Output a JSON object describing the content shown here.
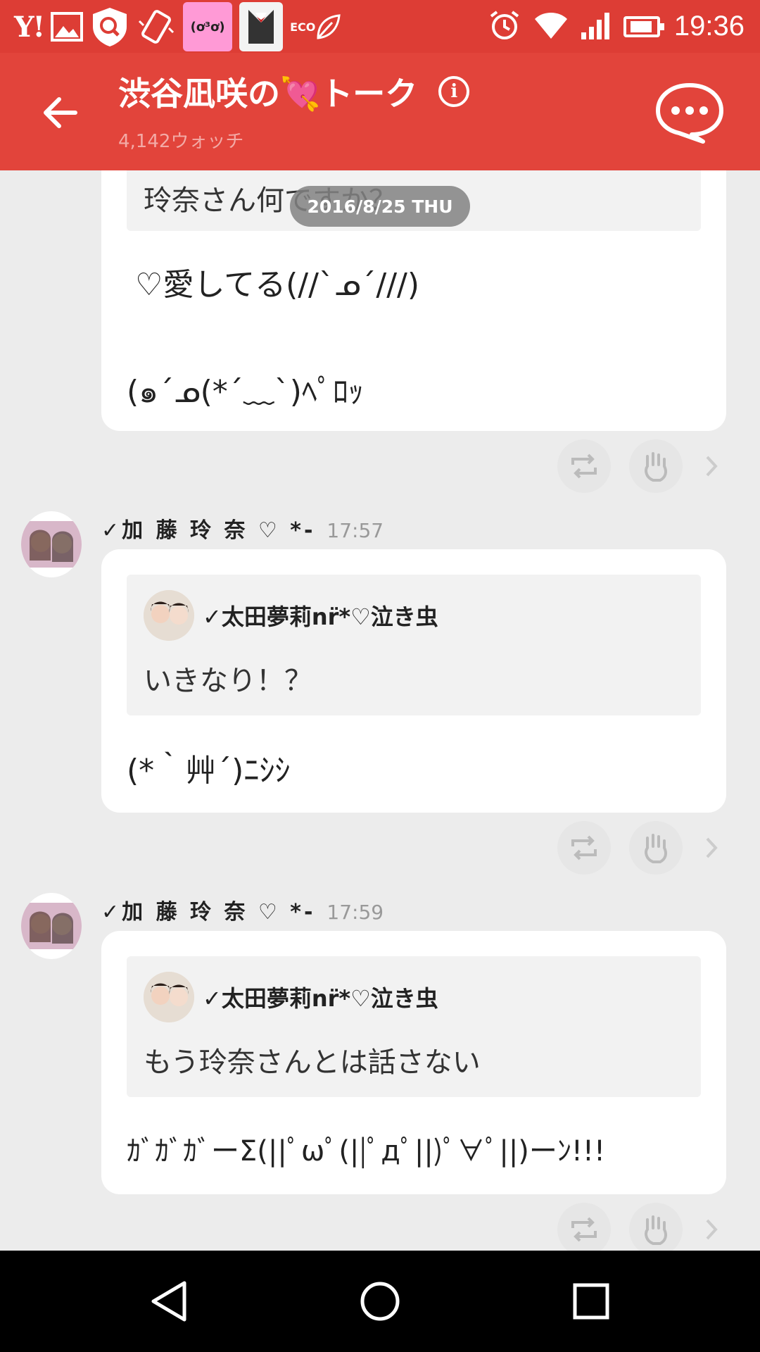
{
  "status_bar": {
    "yahoo": "Y!",
    "sticker_text": "(ơ³ơ)",
    "eco_label": "ECO",
    "time": "19:36"
  },
  "app_bar": {
    "title": "渋谷凪咲の💘トーク",
    "watch_count": "4,142ウォッチ"
  },
  "date_separator": "2016/8/25 THU",
  "messages": [
    {
      "quoted_text": "玲奈さん何ですか？",
      "lines": [
        "♡愛してる(//`ᓄ´///)",
        "(๑´ᓄ(*´﹏`)ﾍﾟﾛｯ"
      ]
    },
    {
      "sender": "✓加 藤 玲 奈 ♡ *-",
      "time": "17:57",
      "quoted_author": "✓太田夢莉nr̈*♡泣き虫",
      "quoted_text": "いきなり！？",
      "lines": [
        "(*｀艸´)ﾆｼｼ"
      ]
    },
    {
      "sender": "✓加 藤 玲 奈 ♡ *-",
      "time": "17:59",
      "quoted_author": "✓太田夢莉nr̈*♡泣き虫",
      "quoted_text": "もう玲奈さんとは話さない",
      "lines": [
        "ｶﾞｶﾞｶﾞーΣ(||ﾟωﾟ(||ﾟдﾟ||)ﾟ∀ﾟ||)ーﾝ!!!"
      ]
    }
  ],
  "icons": {
    "back": "arrow-left-icon",
    "info": "info-icon",
    "chat": "chat-bubble-icon",
    "retweet": "retweet-icon",
    "clap": "hand-icon",
    "chevron": "chevron-right-icon"
  },
  "colors": {
    "brand_red": "#e2443b",
    "status_red": "#dd3d35",
    "background": "#ececec"
  }
}
